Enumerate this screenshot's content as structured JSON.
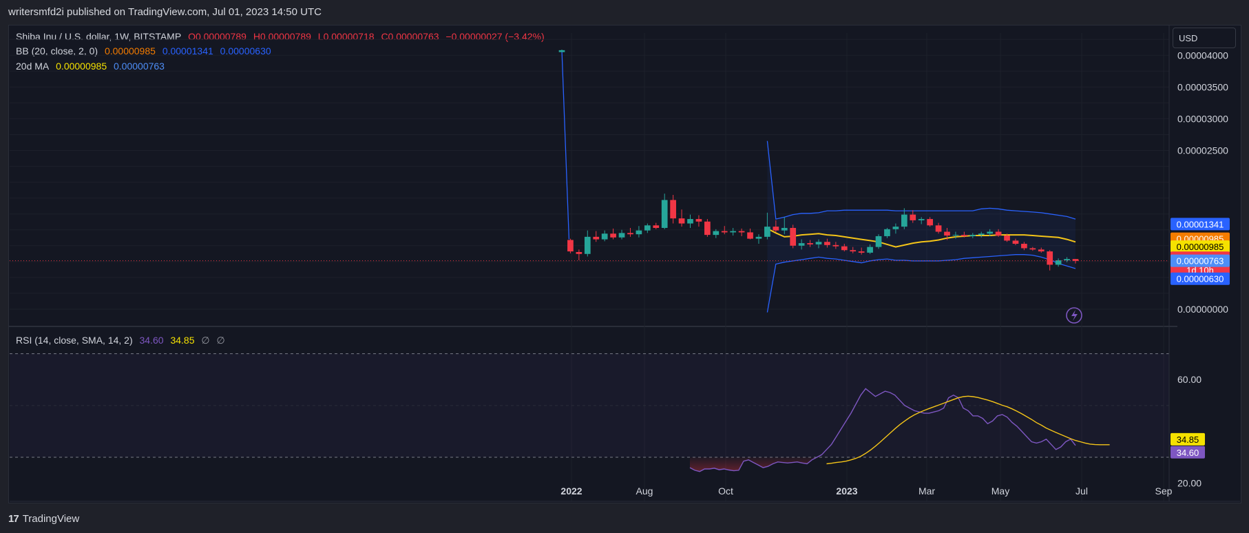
{
  "header": {
    "publisher": "writersmfd2i published on TradingView.com, Jul 01, 2023 14:50 UTC"
  },
  "legend": {
    "symbol": "Shiba Inu / U.S. dollar, 1W, BITSTAMP",
    "o": "O0.00000789",
    "h": "H0.00000789",
    "l": "L0.00000718",
    "c": "C0.00000763",
    "change": "−0.00000027 (−3.42%)",
    "bb_name": "BB (20, close, 2, 0)",
    "bb_basis": "0.00000985",
    "bb_upper": "0.00001341",
    "bb_lower": "0.00000630",
    "ma_name": "20d MA",
    "ma_value1": "0.00000985",
    "ma_value2": "0.00000763"
  },
  "rsi_legend": {
    "name": "RSI (14, close, SMA, 14, 2)",
    "rsi": "34.60",
    "ma": "34.85",
    "sym1": "∅",
    "sym2": "∅"
  },
  "currency": "USD",
  "footer": {
    "brand": "TradingView",
    "logo": "17"
  },
  "colors": {
    "up": "#26a69a",
    "down": "#f23645",
    "bb": "#2962ff",
    "ma": "#f5c518",
    "rsi": "#7e57c2",
    "rsi_ma": "#f5c518"
  },
  "badges": [
    {
      "text": "0.00001341",
      "color": "#2962ff",
      "value": 1.341e-05
    },
    {
      "text": "0.00000985",
      "color": "#f57c00",
      "value": 1.11e-05
    },
    {
      "text": "0.00000985",
      "color": "#f5e100",
      "value": 9.85e-06
    },
    {
      "text": "0.00000763",
      "color": "#f23645",
      "value": 8.1e-06
    },
    {
      "text": "1d 10h",
      "color": "#f23645",
      "value": 6.2e-06
    },
    {
      "text": "0.00000763",
      "color": "#4e8ef7",
      "value": 7.63e-06
    },
    {
      "text": "0.00000630",
      "color": "#2962ff",
      "value": 4.8e-06
    }
  ],
  "rsi_badges": [
    {
      "text": "34.85",
      "color": "#f5e100",
      "value": 34.85
    },
    {
      "text": "34.60",
      "color": "#7e57c2",
      "value": 34.6
    }
  ],
  "chart_data": {
    "type": "candlestick",
    "title": "Shiba Inu / U.S. dollar, 1W, BITSTAMP",
    "price_axis": {
      "ticks": [
        "0.00004000",
        "0.00003500",
        "0.00003000",
        "0.00002500",
        "0.00000000"
      ],
      "tick_values": [
        4e-05,
        3.5e-05,
        3e-05,
        2.5e-05,
        0
      ],
      "ylim": [
        -2.5e-06,
        4.35e-05
      ]
    },
    "time_axis": {
      "labels": [
        "2022",
        "Aug",
        "Oct",
        "2023",
        "Mar",
        "May",
        "Jul",
        "Sep"
      ],
      "bold": [
        "2022",
        "2023"
      ]
    },
    "last_price": 7.63e-06,
    "candles": [
      {
        "o": 4.05e-05,
        "h": 4.09e-05,
        "l": 4.05e-05,
        "c": 4.08e-05
      },
      {
        "o": 1.09e-05,
        "h": 1.11e-05,
        "l": 8.8e-06,
        "c": 9.1e-06
      },
      {
        "o": 9e-06,
        "h": 9.4e-06,
        "l": 7.7e-06,
        "c": 8.7e-06
      },
      {
        "o": 8.7e-06,
        "h": 1.24e-05,
        "l": 8.3e-06,
        "c": 1.14e-05
      },
      {
        "o": 1.14e-05,
        "h": 1.23e-05,
        "l": 1.06e-05,
        "c": 1.1e-05
      },
      {
        "o": 1.1e-05,
        "h": 1.24e-05,
        "l": 1.07e-05,
        "c": 1.19e-05
      },
      {
        "o": 1.19e-05,
        "h": 1.27e-05,
        "l": 1.1e-05,
        "c": 1.13e-05
      },
      {
        "o": 1.13e-05,
        "h": 1.25e-05,
        "l": 1.1e-05,
        "c": 1.2e-05
      },
      {
        "o": 1.2e-05,
        "h": 1.28e-05,
        "l": 1.14e-05,
        "c": 1.18e-05
      },
      {
        "o": 1.18e-05,
        "h": 1.31e-05,
        "l": 1.13e-05,
        "c": 1.24e-05
      },
      {
        "o": 1.24e-05,
        "h": 1.35e-05,
        "l": 1.2e-05,
        "c": 1.32e-05
      },
      {
        "o": 1.32e-05,
        "h": 1.36e-05,
        "l": 1.26e-05,
        "c": 1.28e-05
      },
      {
        "o": 1.28e-05,
        "h": 1.82e-05,
        "l": 1.26e-05,
        "c": 1.72e-05
      },
      {
        "o": 1.72e-05,
        "h": 1.8e-05,
        "l": 1.35e-05,
        "c": 1.43e-05
      },
      {
        "o": 1.43e-05,
        "h": 1.57e-05,
        "l": 1.3e-05,
        "c": 1.35e-05
      },
      {
        "o": 1.35e-05,
        "h": 1.49e-05,
        "l": 1.28e-05,
        "c": 1.42e-05
      },
      {
        "o": 1.42e-05,
        "h": 1.48e-05,
        "l": 1.3e-05,
        "c": 1.38e-05
      },
      {
        "o": 1.38e-05,
        "h": 1.42e-05,
        "l": 1.14e-05,
        "c": 1.17e-05
      },
      {
        "o": 1.17e-05,
        "h": 1.26e-05,
        "l": 1.12e-05,
        "c": 1.23e-05
      },
      {
        "o": 1.23e-05,
        "h": 1.31e-05,
        "l": 1.18e-05,
        "c": 1.21e-05
      },
      {
        "o": 1.21e-05,
        "h": 1.28e-05,
        "l": 1.16e-05,
        "c": 1.23e-05
      },
      {
        "o": 1.23e-05,
        "h": 1.27e-05,
        "l": 1.15e-05,
        "c": 1.21e-05
      },
      {
        "o": 1.21e-05,
        "h": 1.27e-05,
        "l": 1.1e-05,
        "c": 1.11e-05
      },
      {
        "o": 1.11e-05,
        "h": 1.18e-05,
        "l": 1.03e-05,
        "c": 1.14e-05
      },
      {
        "o": 1.14e-05,
        "h": 1.52e-05,
        "l": 1.1e-05,
        "c": 1.3e-05
      },
      {
        "o": 1.3e-05,
        "h": 1.4e-05,
        "l": 1.21e-05,
        "c": 1.24e-05
      },
      {
        "o": 1.24e-05,
        "h": 1.45e-05,
        "l": 1.18e-05,
        "c": 1.28e-05
      },
      {
        "o": 1.28e-05,
        "h": 1.33e-05,
        "l": 9.6e-06,
        "c": 1e-05
      },
      {
        "o": 1e-05,
        "h": 1.1e-05,
        "l": 9.4e-06,
        "c": 1.04e-05
      },
      {
        "o": 1.04e-05,
        "h": 1.09e-05,
        "l": 9.8e-06,
        "c": 1.02e-05
      },
      {
        "o": 1.02e-05,
        "h": 1.1e-05,
        "l": 9.6e-06,
        "c": 1.06e-05
      },
      {
        "o": 1.06e-05,
        "h": 1.11e-05,
        "l": 9.7e-06,
        "c": 1.01e-05
      },
      {
        "o": 1.01e-05,
        "h": 1.06e-05,
        "l": 9.5e-06,
        "c": 9.9e-06
      },
      {
        "o": 9.9e-06,
        "h": 1.03e-05,
        "l": 9.1e-06,
        "c": 9.3e-06
      },
      {
        "o": 9.3e-06,
        "h": 9.8e-06,
        "l": 8.8e-06,
        "c": 9.1e-06
      },
      {
        "o": 9.1e-06,
        "h": 9.7e-06,
        "l": 8.6e-06,
        "c": 8.9e-06
      },
      {
        "o": 8.9e-06,
        "h": 1.02e-05,
        "l": 8.7e-06,
        "c": 9.8e-06
      },
      {
        "o": 9.8e-06,
        "h": 1.18e-05,
        "l": 9.5e-06,
        "c": 1.15e-05
      },
      {
        "o": 1.15e-05,
        "h": 1.28e-05,
        "l": 1.12e-05,
        "c": 1.26e-05
      },
      {
        "o": 1.26e-05,
        "h": 1.35e-05,
        "l": 1.19e-05,
        "c": 1.3e-05
      },
      {
        "o": 1.3e-05,
        "h": 1.59e-05,
        "l": 1.26e-05,
        "c": 1.49e-05
      },
      {
        "o": 1.49e-05,
        "h": 1.56e-05,
        "l": 1.36e-05,
        "c": 1.4e-05
      },
      {
        "o": 1.4e-05,
        "h": 1.45e-05,
        "l": 1.34e-05,
        "c": 1.42e-05
      },
      {
        "o": 1.42e-05,
        "h": 1.45e-05,
        "l": 1.3e-05,
        "c": 1.32e-05
      },
      {
        "o": 1.32e-05,
        "h": 1.36e-05,
        "l": 1.19e-05,
        "c": 1.22e-05
      },
      {
        "o": 1.22e-05,
        "h": 1.28e-05,
        "l": 1.09e-05,
        "c": 1.16e-05
      },
      {
        "o": 1.16e-05,
        "h": 1.22e-05,
        "l": 1.11e-05,
        "c": 1.17e-05
      },
      {
        "o": 1.17e-05,
        "h": 1.22e-05,
        "l": 1.13e-05,
        "c": 1.15e-05
      },
      {
        "o": 1.15e-05,
        "h": 1.2e-05,
        "l": 1.12e-05,
        "c": 1.17e-05
      },
      {
        "o": 1.17e-05,
        "h": 1.22e-05,
        "l": 1.13e-05,
        "c": 1.19e-05
      },
      {
        "o": 1.19e-05,
        "h": 1.26e-05,
        "l": 1.15e-05,
        "c": 1.22e-05
      },
      {
        "o": 1.22e-05,
        "h": 1.26e-05,
        "l": 1.14e-05,
        "c": 1.16e-05
      },
      {
        "o": 1.16e-05,
        "h": 1.19e-05,
        "l": 1.06e-05,
        "c": 1.08e-05
      },
      {
        "o": 1.08e-05,
        "h": 1.11e-05,
        "l": 1.01e-05,
        "c": 1.03e-05
      },
      {
        "o": 1.03e-05,
        "h": 1.06e-05,
        "l": 9.3e-06,
        "c": 9.6e-06
      },
      {
        "o": 9.6e-06,
        "h": 9.8e-06,
        "l": 9.2e-06,
        "c": 9.4e-06
      },
      {
        "o": 9.4e-06,
        "h": 9.7e-06,
        "l": 8.9e-06,
        "c": 9.1e-06
      },
      {
        "o": 9.1e-06,
        "h": 9.3e-06,
        "l": 6.1e-06,
        "c": 7e-06
      },
      {
        "o": 7e-06,
        "h": 8e-06,
        "l": 6.7e-06,
        "c": 7.7e-06
      },
      {
        "o": 7.7e-06,
        "h": 8.2e-06,
        "l": 7.4e-06,
        "c": 7.9e-06
      },
      {
        "o": 7.9e-06,
        "h": 7.9e-06,
        "l": 7.2e-06,
        "c": 7.6e-06
      }
    ],
    "bb_upper": [
      2.65e-05,
      1.42e-05,
      1.45e-05,
      1.49e-05,
      1.51e-05,
      1.51e-05,
      1.52e-05,
      1.55e-05,
      1.55e-05,
      1.56e-05,
      1.56e-05,
      1.56e-05,
      1.56e-05,
      1.56e-05,
      1.56e-05,
      1.55e-05,
      1.55e-05,
      1.55e-05,
      1.55e-05,
      1.55e-05,
      1.55e-05,
      1.55e-05,
      1.55e-05,
      1.55e-05,
      1.55e-05,
      1.58e-05,
      1.59e-05,
      1.58e-05,
      1.56e-05,
      1.55e-05,
      1.54e-05,
      1.53e-05,
      1.52e-05,
      1.5e-05,
      1.48e-05,
      1.46e-05,
      1.42e-05
    ],
    "bb_lower": [
      -5e-07,
      7.1e-06,
      7.4e-06,
      7.6e-06,
      7.8e-06,
      8e-06,
      8.2e-06,
      8e-06,
      7.9e-06,
      7.7e-06,
      7.5e-06,
      7.3e-06,
      7.6e-06,
      7.8e-06,
      7.9e-06,
      7.7e-06,
      7.7e-06,
      7.6e-06,
      7.6e-06,
      7.6e-06,
      7.6e-06,
      7.7e-06,
      7.8e-06,
      8e-06,
      8.1e-06,
      8.2e-06,
      8.3e-06,
      8.4e-06,
      8.5e-06,
      8.6e-06,
      8.6e-06,
      8.5e-06,
      8.2e-06,
      7.8e-06,
      7.2e-06,
      6.8e-06,
      6.4e-06
    ],
    "bb_basis": [
      1.27e-05,
      1.2e-05,
      1.14e-05,
      1.15e-05,
      1.17e-05,
      1.18e-05,
      1.19e-05,
      1.17e-05,
      1.16e-05,
      1.14e-05,
      1.12e-05,
      1.1e-05,
      1.08e-05,
      1.06e-05,
      1.02e-05,
      9.8e-06,
      1.01e-05,
      1.04e-05,
      1.06e-05,
      1.07e-05,
      1.09e-05,
      1.12e-05,
      1.14e-05,
      1.15e-05,
      1.16e-05,
      1.16e-05,
      1.16e-05,
      1.17e-05,
      1.17e-05,
      1.17e-05,
      1.17e-05,
      1.16e-05,
      1.15e-05,
      1.14e-05,
      1.13e-05,
      1.1e-05,
      1.06e-05
    ],
    "rsi_axis": {
      "ticks": [
        "60.00",
        "20.00"
      ],
      "tick_values": [
        60,
        20
      ],
      "ylim": [
        13,
        80
      ],
      "bands": [
        70,
        30
      ],
      "mid": 50
    },
    "rsi": [
      26,
      25,
      24.5,
      25.5,
      25.5,
      25.8,
      25.2,
      25.5,
      25.1,
      24.8,
      25,
      28.5,
      29,
      28,
      27,
      26,
      26.5,
      27.5,
      28.2,
      28,
      27.8,
      28,
      28.2,
      27.8,
      27.5,
      29,
      30,
      31,
      33,
      35,
      38,
      41,
      44,
      47,
      50.5,
      54,
      56.5,
      55,
      53.5,
      54.5,
      55.5,
      55,
      54,
      52,
      50,
      49,
      48,
      47.5,
      47,
      47,
      47.5,
      48,
      49,
      53,
      54,
      53,
      49,
      48,
      46,
      46,
      45,
      43,
      44,
      46,
      46.5,
      45.5,
      43.5,
      42,
      40,
      38,
      36,
      35.5,
      36,
      37,
      35,
      33,
      34,
      36,
      37,
      34.6
    ],
    "rsi_ma": [
      null,
      null,
      null,
      null,
      null,
      null,
      null,
      null,
      null,
      null,
      null,
      null,
      null,
      null,
      null,
      null,
      null,
      null,
      null,
      null,
      null,
      null,
      null,
      null,
      null,
      null,
      null,
      null,
      27.5,
      27.7,
      28,
      28.2,
      28.5,
      29,
      29.6,
      30.4,
      31.5,
      32.8,
      34.3,
      35.9,
      37.6,
      39.3,
      41,
      42.6,
      44,
      45.3,
      46.4,
      47.3,
      48.1,
      48.8,
      49.5,
      50.2,
      50.9,
      51.6,
      52.3,
      53,
      53.4,
      53.6,
      53.4,
      53.1,
      52.6,
      52.1,
      51.5,
      50.8,
      50.1,
      49.5,
      48.7,
      47.8,
      46.8,
      45.7,
      44.6,
      43.4,
      42.4,
      41.3,
      40.4,
      39.6,
      38.8,
      38,
      37.2,
      36.5,
      36,
      35.5,
      35.1,
      34.9,
      34.85,
      34.85,
      34.85
    ]
  }
}
